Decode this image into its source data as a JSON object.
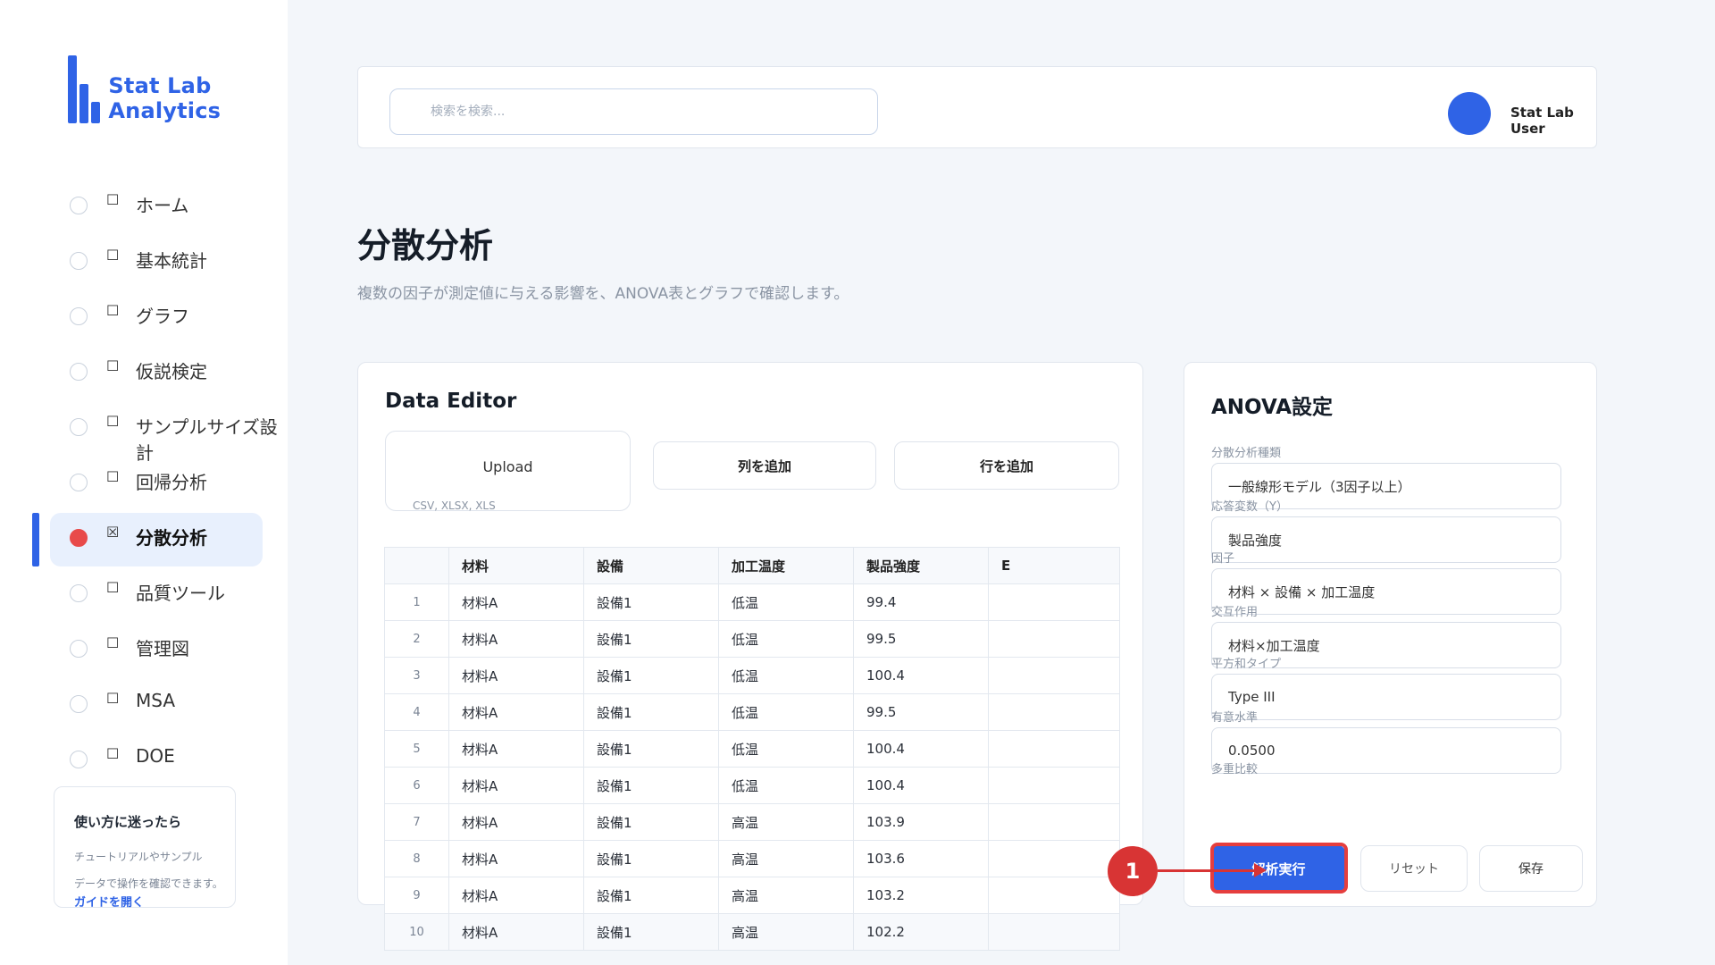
{
  "app": {
    "name": "Stat Lab Analytics"
  },
  "sidebar": {
    "items": [
      {
        "label": "ホーム",
        "checkbox": "☐",
        "active": false
      },
      {
        "label": "基本統計",
        "checkbox": "☐",
        "active": false
      },
      {
        "label": "グラフ",
        "checkbox": "☐",
        "active": false
      },
      {
        "label": "仮説検定",
        "checkbox": "☐",
        "active": false
      },
      {
        "label": "サンプルサイズ設計",
        "checkbox": "☐",
        "active": false
      },
      {
        "label": "回帰分析",
        "checkbox": "☐",
        "active": false
      },
      {
        "label": "分散分析",
        "checkbox": "☒",
        "active": true
      },
      {
        "label": "品質ツール",
        "checkbox": "☐",
        "active": false
      },
      {
        "label": "管理図",
        "checkbox": "☐",
        "active": false
      },
      {
        "label": "MSA",
        "checkbox": "☐",
        "active": false
      },
      {
        "label": "DOE",
        "checkbox": "☐",
        "active": false
      }
    ],
    "help": {
      "title": "使い方に迷ったら",
      "desc_line1": "チュートリアルやサンプル",
      "desc_line2": "データで操作を確認できます。",
      "link": "ガイドを開く"
    }
  },
  "header": {
    "search_placeholder": "検索を検索...",
    "user_name": "Stat Lab User"
  },
  "page": {
    "title": "分散分析",
    "subtitle": "複数の因子が測定値に与える影響を、ANOVA表とグラフで確認します。"
  },
  "editor": {
    "title": "Data Editor",
    "upload_label": "Upload",
    "upload_formats": "CSV, XLSX, XLS",
    "add_column": "列を追加",
    "add_row": "行を追加",
    "columns": [
      "",
      "材料",
      "設備",
      "加工温度",
      "製品強度",
      "E"
    ],
    "rows": [
      [
        "1",
        "材料A",
        "設備1",
        "低温",
        "99.4",
        ""
      ],
      [
        "2",
        "材料A",
        "設備1",
        "低温",
        "99.5",
        ""
      ],
      [
        "3",
        "材料A",
        "設備1",
        "低温",
        "100.4",
        ""
      ],
      [
        "4",
        "材料A",
        "設備1",
        "低温",
        "99.5",
        ""
      ],
      [
        "5",
        "材料A",
        "設備1",
        "低温",
        "100.4",
        ""
      ],
      [
        "6",
        "材料A",
        "設備1",
        "低温",
        "100.4",
        ""
      ],
      [
        "7",
        "材料A",
        "設備1",
        "高温",
        "103.9",
        ""
      ],
      [
        "8",
        "材料A",
        "設備1",
        "高温",
        "103.6",
        ""
      ],
      [
        "9",
        "材料A",
        "設備1",
        "高温",
        "103.2",
        ""
      ],
      [
        "10",
        "材料A",
        "設備1",
        "高温",
        "102.2",
        ""
      ]
    ]
  },
  "settings": {
    "title": "ANOVA設定",
    "fields": [
      {
        "label": "分散分析種類",
        "value": "一般線形モデル（3因子以上）"
      },
      {
        "label": "応答変数（Y）",
        "value": "製品強度"
      },
      {
        "label": "因子",
        "value": "材料 × 設備 × 加工温度"
      },
      {
        "label": "交互作用",
        "value": "材料×加工温度"
      },
      {
        "label": "平方和タイプ",
        "value": "Type III"
      },
      {
        "label": "有意水準",
        "value": "0.0500"
      },
      {
        "label": "多重比較",
        "value": ""
      }
    ],
    "run_label": "解析実行",
    "reset_label": "リセット",
    "save_label": "保存"
  },
  "annotation": {
    "badge": "1"
  },
  "colors": {
    "accent": "#2f63e6",
    "annotation": "#d83434"
  }
}
